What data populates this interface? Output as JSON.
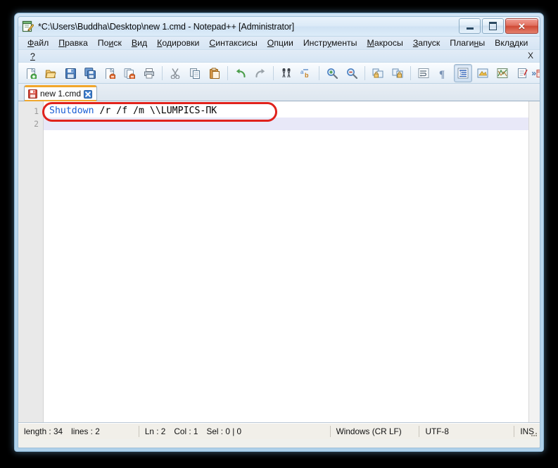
{
  "window": {
    "title": "*C:\\Users\\Buddha\\Desktop\\new 1.cmd - Notepad++ [Administrator]",
    "app_icon": "notepad-plus-plus-icon",
    "minimize_label": "–",
    "maximize_label": "□",
    "close_label": "✕",
    "frame_color": "#aed0ea"
  },
  "menu": {
    "items": [
      {
        "pre": "",
        "accel": "Ф",
        "post": "айл"
      },
      {
        "pre": "",
        "accel": "П",
        "post": "равка"
      },
      {
        "pre": "По",
        "accel": "и",
        "post": "ск"
      },
      {
        "pre": "",
        "accel": "В",
        "post": "ид"
      },
      {
        "pre": "",
        "accel": "К",
        "post": "одировки"
      },
      {
        "pre": "",
        "accel": "С",
        "post": "интаксисы"
      },
      {
        "pre": "",
        "accel": "О",
        "post": "пции"
      },
      {
        "pre": "Инстр",
        "accel": "у",
        "post": "менты"
      },
      {
        "pre": "",
        "accel": "М",
        "post": "акросы"
      },
      {
        "pre": "",
        "accel": "З",
        "post": "апуск"
      },
      {
        "pre": "Плаги",
        "accel": "н",
        "post": "ы"
      },
      {
        "pre": "Вкл",
        "accel": "а",
        "post": "дки"
      }
    ],
    "help_item": "?",
    "document_close_label": "X"
  },
  "toolbar": {
    "buttons": [
      {
        "name": "new-file-icon",
        "title": "Новый"
      },
      {
        "name": "open-file-icon",
        "title": "Открыть"
      },
      {
        "name": "save-icon",
        "title": "Сохранить"
      },
      {
        "name": "save-all-icon",
        "title": "Сохранить все"
      },
      {
        "name": "close-file-icon",
        "title": "Закрыть"
      },
      {
        "name": "close-all-icon",
        "title": "Закрыть все"
      },
      {
        "name": "print-icon",
        "title": "Печать"
      },
      {
        "name": "separator"
      },
      {
        "name": "cut-icon",
        "title": "Вырезать"
      },
      {
        "name": "copy-icon",
        "title": "Копировать"
      },
      {
        "name": "paste-icon",
        "title": "Вставить"
      },
      {
        "name": "separator"
      },
      {
        "name": "undo-icon",
        "title": "Отменить"
      },
      {
        "name": "redo-icon",
        "title": "Вернуть"
      },
      {
        "name": "separator"
      },
      {
        "name": "find-icon",
        "title": "Найти"
      },
      {
        "name": "replace-icon",
        "title": "Заменить"
      },
      {
        "name": "separator"
      },
      {
        "name": "zoom-in-icon",
        "title": "Увеличить"
      },
      {
        "name": "zoom-out-icon",
        "title": "Уменьшить"
      },
      {
        "name": "separator"
      },
      {
        "name": "sync-vertical-scroll-icon",
        "title": "Синхронная вертикальная прокрутка"
      },
      {
        "name": "sync-horizontal-scroll-icon",
        "title": "Синхронная горизонтальная прокрутка"
      },
      {
        "name": "separator"
      },
      {
        "name": "word-wrap-icon",
        "title": "Перенос строк"
      },
      {
        "name": "show-all-characters-icon",
        "title": "Отображать все символы"
      },
      {
        "name": "indent-guide-icon",
        "title": "Направляющие отступов",
        "pressed": true
      },
      {
        "name": "user-defined-language-icon",
        "title": "Пользовательские стили"
      },
      {
        "name": "document-map-icon",
        "title": "Карта документа"
      },
      {
        "name": "function-list-icon",
        "title": "Список функций"
      },
      {
        "name": "folder-as-workspace-icon",
        "title": "Папка как рабочая область"
      },
      {
        "name": "monitoring-icon",
        "title": "Мониторинг"
      },
      {
        "name": "separator"
      },
      {
        "name": "record-macro-icon",
        "title": "Начать запись"
      },
      {
        "name": "stop-macro-icon",
        "title": "Остановить запись"
      }
    ],
    "overflow_label": "»"
  },
  "tabs": [
    {
      "label": "new 1.cmd",
      "modified": true,
      "save_icon": "floppy-disk-red-icon",
      "close_icon": "tab-close-icon"
    }
  ],
  "editor": {
    "gutter_lines": [
      "1",
      "2"
    ],
    "lines": [
      {
        "tokens": [
          {
            "text": "Shutdown",
            "kind": "keyword"
          },
          {
            "text": " /r /f /m \\\\LUMPICS-ПК",
            "kind": "plain"
          }
        ],
        "current": false
      },
      {
        "tokens": [
          {
            "text": "",
            "kind": "plain"
          }
        ],
        "current": true
      }
    ],
    "keyword_color": "#1a5fd6",
    "current_line_color": "#e8e8f8"
  },
  "annotation": {
    "shape": "rounded-rectangle",
    "color": "#e0221c",
    "target": "line-1-command"
  },
  "status_bar": {
    "length_label": "length : 34",
    "lines_label": "lines : 2",
    "ln_label": "Ln : 2",
    "col_label": "Col : 1",
    "sel_label": "Sel : 0 | 0",
    "eol_label": "Windows (CR LF)",
    "encoding_label": "UTF-8",
    "insert_mode_label": "INS"
  }
}
